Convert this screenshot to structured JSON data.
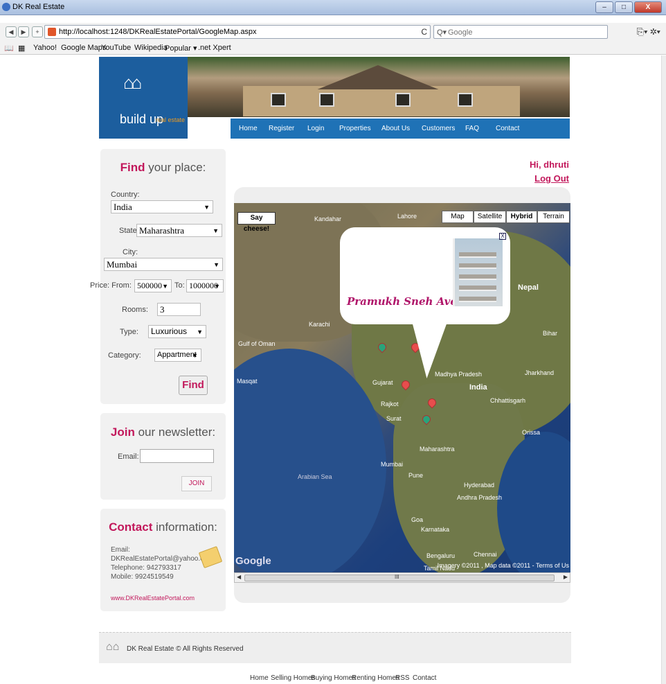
{
  "window": {
    "title": "DK Real Estate",
    "min": "–",
    "max": "□",
    "close": "X"
  },
  "browser": {
    "url": "http://localhost:1248/DKRealEstatePortal/GoogleMap.aspx",
    "search_placeholder": "Google",
    "back": "◀",
    "forward": "▶",
    "add": "+",
    "reload": "C",
    "tools": "⎘▾ ✲▾"
  },
  "bookmarks": [
    "Yahoo!",
    "Google Maps",
    "YouTube",
    "Wikipedia",
    "Popular ▾",
    ".net Xpert"
  ],
  "site": {
    "brand": "build up",
    "brand_sub": "real estate",
    "menu": [
      "Home",
      "Register",
      "Login",
      "Properties",
      "About Us",
      "Customers",
      "FAQ",
      "Contact"
    ]
  },
  "find": {
    "title_bold": "Find",
    "title_rest": " your place:",
    "country_label": "Country:",
    "country": "India",
    "state_label": "State:",
    "state": "Maharashtra",
    "city_label": "City:",
    "city": "Mumbai",
    "price_label": "Price: From:",
    "price_from": "500000",
    "price_to_label": "To:",
    "price_to": "1000000",
    "rooms_label": "Rooms:",
    "rooms": "3",
    "type_label": "Type:",
    "type": "Luxurious",
    "category_label": "Category:",
    "category": "Appartment",
    "button": "Find"
  },
  "newsletter": {
    "title_bold": "Join",
    "title_rest": " our newsletter:",
    "email_label": "Email:",
    "button": "JOIN"
  },
  "contact": {
    "title_bold": "Contact",
    "title_rest": " information:",
    "email_label": "Email:",
    "email": "DKRealEstatePortal@yahoo.com",
    "telephone": "Telephone: 942793317",
    "mobile": "Mobile: 9924519549",
    "website": "www.DKRealEstatePortal.com"
  },
  "user": {
    "greeting": "Hi, dhruti",
    "logout": "Log Out"
  },
  "map": {
    "say_cheese": "Say cheese!",
    "types": [
      "Map",
      "Satellite",
      "Hybrid",
      "Terrain"
    ],
    "active_type": "Hybrid",
    "popup_title": "Pramukh Sneh Avenue",
    "close": "X",
    "scroll_grip": "III",
    "labels": [
      "Lahore",
      "Kandahar",
      "Nepal",
      "Bihar",
      "Karachi",
      "Gulf of Oman",
      "Madhya Pradesh",
      "India",
      "Gujarat",
      "Rajkot",
      "Surat",
      "Jharkhand",
      "Masqat",
      "Chhattisgarh",
      "Orissa",
      "Maharashtra",
      "Mumbai",
      "Pune",
      "Hyderabad",
      "Andhra Pradesh",
      "Arabian Sea",
      "Goa",
      "Karnataka",
      "Bengaluru",
      "Chennai",
      "Tamil Nadu"
    ],
    "attribution": "Imagery ©2011 , Map data ©2011 - Terms of Us"
  },
  "footer": {
    "copyright": "DK Real Estate © All Rights Reserved",
    "links": [
      "Home",
      "Selling Homes",
      "Buying Homes",
      "Renting Homes",
      "RSS",
      "Contact"
    ]
  }
}
